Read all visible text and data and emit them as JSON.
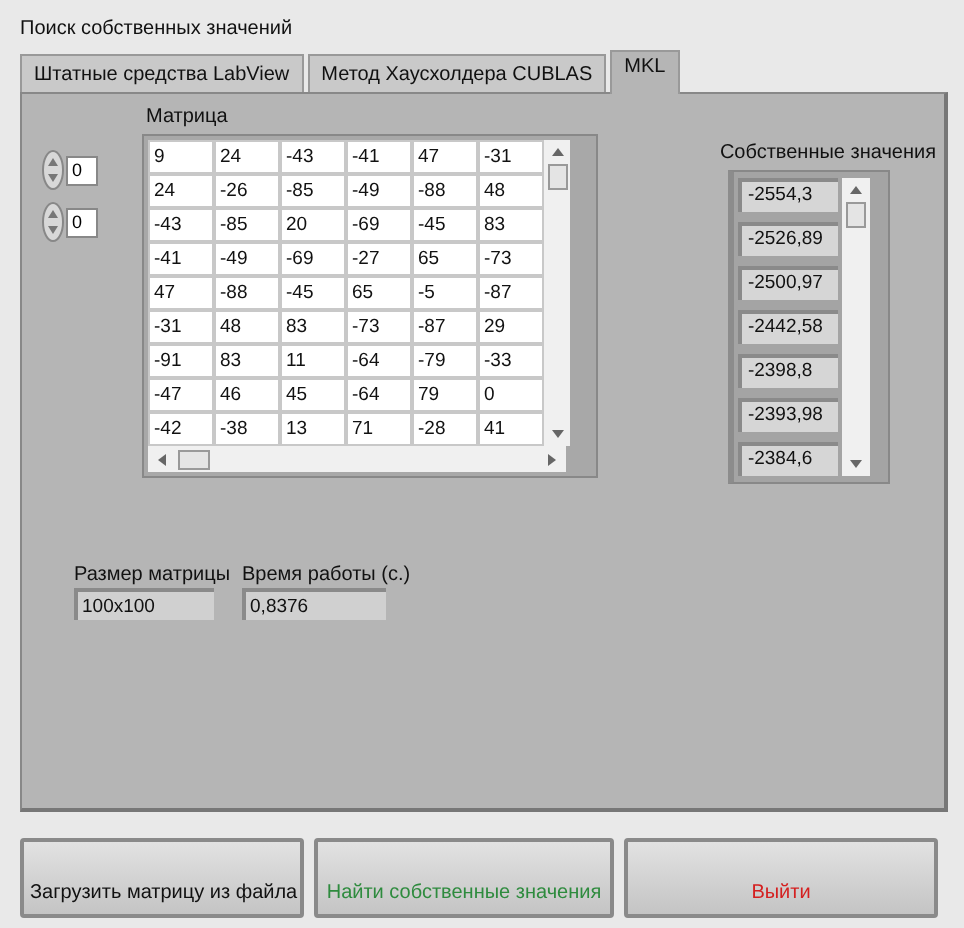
{
  "window": {
    "title": "Поиск собственных значений"
  },
  "tabs": [
    {
      "label": "Штатные средства LabView",
      "selected": false
    },
    {
      "label": "Метод Хаусхолдера CUBLAS",
      "selected": false
    },
    {
      "label": "MKL",
      "selected": true
    }
  ],
  "matrix": {
    "label": "Матрица",
    "index_controls": [
      "0",
      "0"
    ],
    "rows": [
      [
        "9",
        "24",
        "-43",
        "-41",
        "47",
        "-31"
      ],
      [
        "24",
        "-26",
        "-85",
        "-49",
        "-88",
        "48"
      ],
      [
        "-43",
        "-85",
        "20",
        "-69",
        "-45",
        "83"
      ],
      [
        "-41",
        "-49",
        "-69",
        "-27",
        "65",
        "-73"
      ],
      [
        "47",
        "-88",
        "-45",
        "65",
        "-5",
        "-87"
      ],
      [
        "-31",
        "48",
        "83",
        "-73",
        "-87",
        "29"
      ],
      [
        "-91",
        "83",
        "11",
        "-64",
        "-79",
        "-33"
      ],
      [
        "-47",
        "46",
        "45",
        "-64",
        "79",
        "0"
      ],
      [
        "-42",
        "-38",
        "13",
        "71",
        "-28",
        "41"
      ]
    ]
  },
  "eigenvalues": {
    "label": "Собственные значения",
    "values": [
      "-2554,3",
      "-2526,89",
      "-2500,97",
      "-2442,58",
      "-2398,8",
      "-2393,98",
      "-2384,6"
    ]
  },
  "indicators": [
    {
      "label": "Размер матрицы",
      "value": "100x100"
    },
    {
      "label": "Время работы (с.)",
      "value": "0,8376"
    }
  ],
  "buttons": [
    {
      "label": "Загрузить матрицу из файла",
      "kind": "neutral"
    },
    {
      "label": "Найти собственные значения",
      "kind": "primary"
    },
    {
      "label": "Выйти",
      "kind": "danger"
    }
  ]
}
